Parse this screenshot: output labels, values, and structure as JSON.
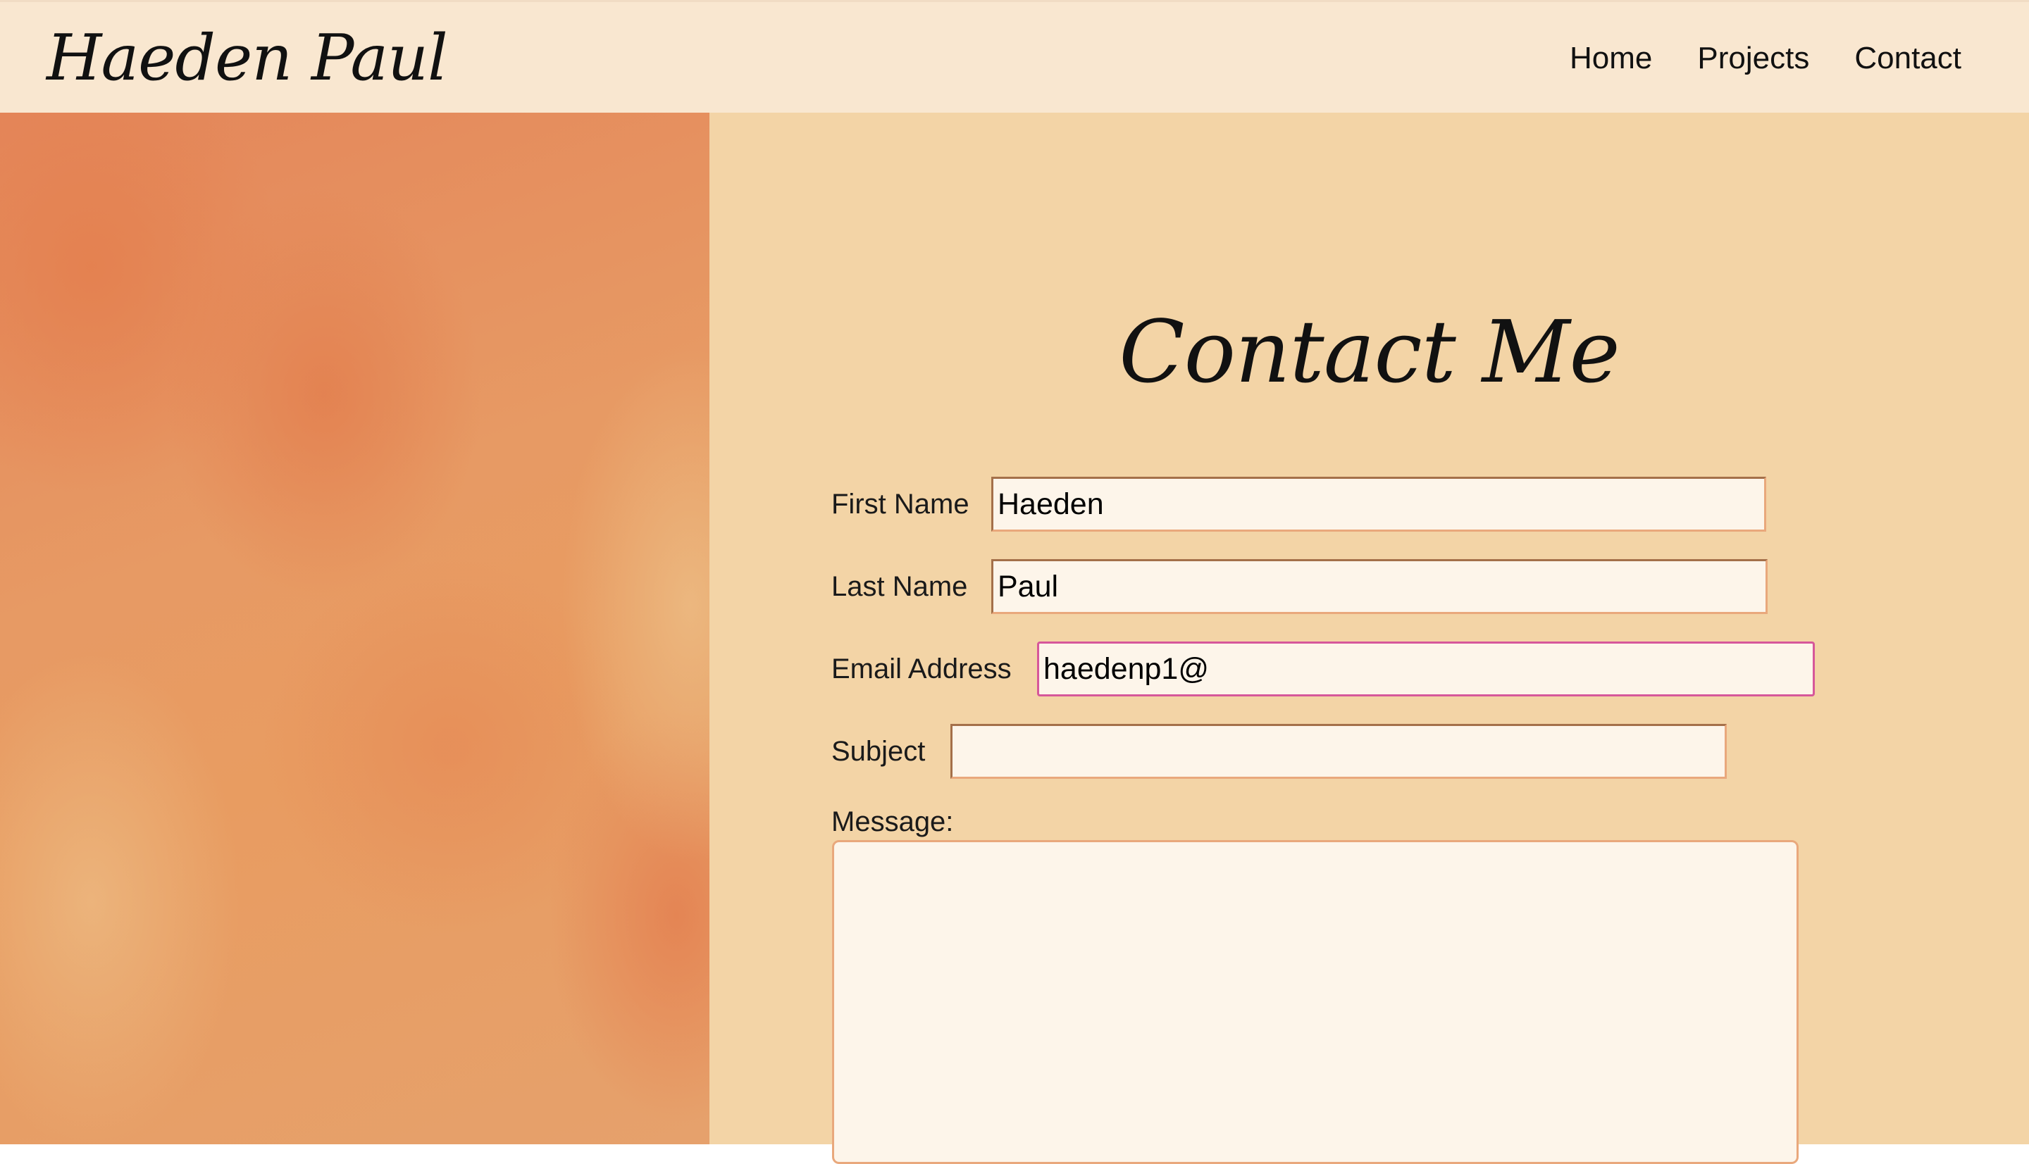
{
  "header": {
    "logo": "Haeden Paul",
    "nav": [
      "Home",
      "Projects",
      "Contact"
    ]
  },
  "contact": {
    "title": "Contact Me",
    "first_name": {
      "label": "First Name",
      "value": "Haeden"
    },
    "last_name": {
      "label": "Last Name",
      "value": "Paul"
    },
    "email": {
      "label": "Email Address",
      "value": "haedenp1@"
    },
    "subject": {
      "label": "Subject",
      "value": ""
    },
    "message": {
      "label": "Message:",
      "value": ""
    }
  },
  "colors": {
    "header_bg": "#f9e7d0",
    "form_bg": "#f3d4a6",
    "input_bg": "#fdf5ea",
    "input_border": "#e9a87c",
    "focus_border": "#d6579a",
    "gradient_orange": "#e4865a"
  }
}
